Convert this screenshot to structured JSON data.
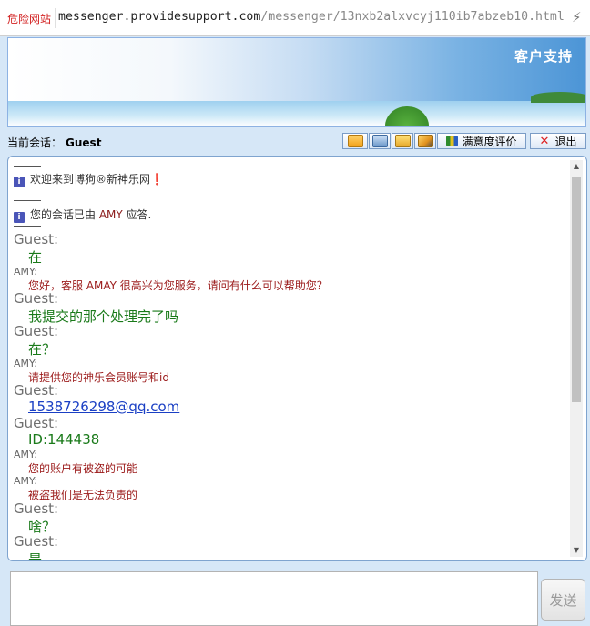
{
  "browser": {
    "security_label": "危险网站",
    "url_host": "messenger.providesupport.com",
    "url_path": "/messenger/13nxb2alxvcyj110ib7abzeb10.html",
    "bolt_icon": "lightning-icon"
  },
  "banner": {
    "title": "客户支持"
  },
  "session": {
    "label": "当前会话：",
    "user": "Guest"
  },
  "toolbar": {
    "icons": [
      "send-file-icon",
      "print-icon",
      "email-icon",
      "edit-icon"
    ],
    "rating_label": "满意度评价",
    "exit_label": "退出"
  },
  "chat": {
    "system": [
      {
        "text": "欢迎来到博狗®新神乐网❗"
      },
      {
        "prefix": "您的会话已由 ",
        "agent": "AMY",
        "suffix": " 应答."
      }
    ],
    "messages": [
      {
        "sender": "Guest:",
        "text": "在"
      },
      {
        "sender": "AMY:",
        "text": "您好，客服 AMAY 很高兴为您服务，请问有什么可以帮助您？"
      },
      {
        "sender": "Guest:",
        "text": "我提交的那个处理完了吗"
      },
      {
        "sender": "Guest:",
        "text": "在？"
      },
      {
        "sender": "AMY:",
        "text": "请提供您的神乐会员账号和id"
      },
      {
        "sender": "Guest:",
        "text": "1538726298@qq.com"
      },
      {
        "sender": "Guest:",
        "text": "ID:144438"
      },
      {
        "sender": "AMY:",
        "text": "您的账户有被盗的可能"
      },
      {
        "sender": "AMY:",
        "text": "被盗我们是无法负责的"
      },
      {
        "sender": "Guest:",
        "text": "啥？"
      },
      {
        "sender": "Guest:",
        "text": "是"
      }
    ]
  },
  "composer": {
    "value": "",
    "send_label": "发送"
  },
  "colors": {
    "guest_text": "#1a7a1a",
    "agent_text": "#9b1a1a",
    "link": "#1a3fc4",
    "panel_border": "#7fa4cf"
  }
}
